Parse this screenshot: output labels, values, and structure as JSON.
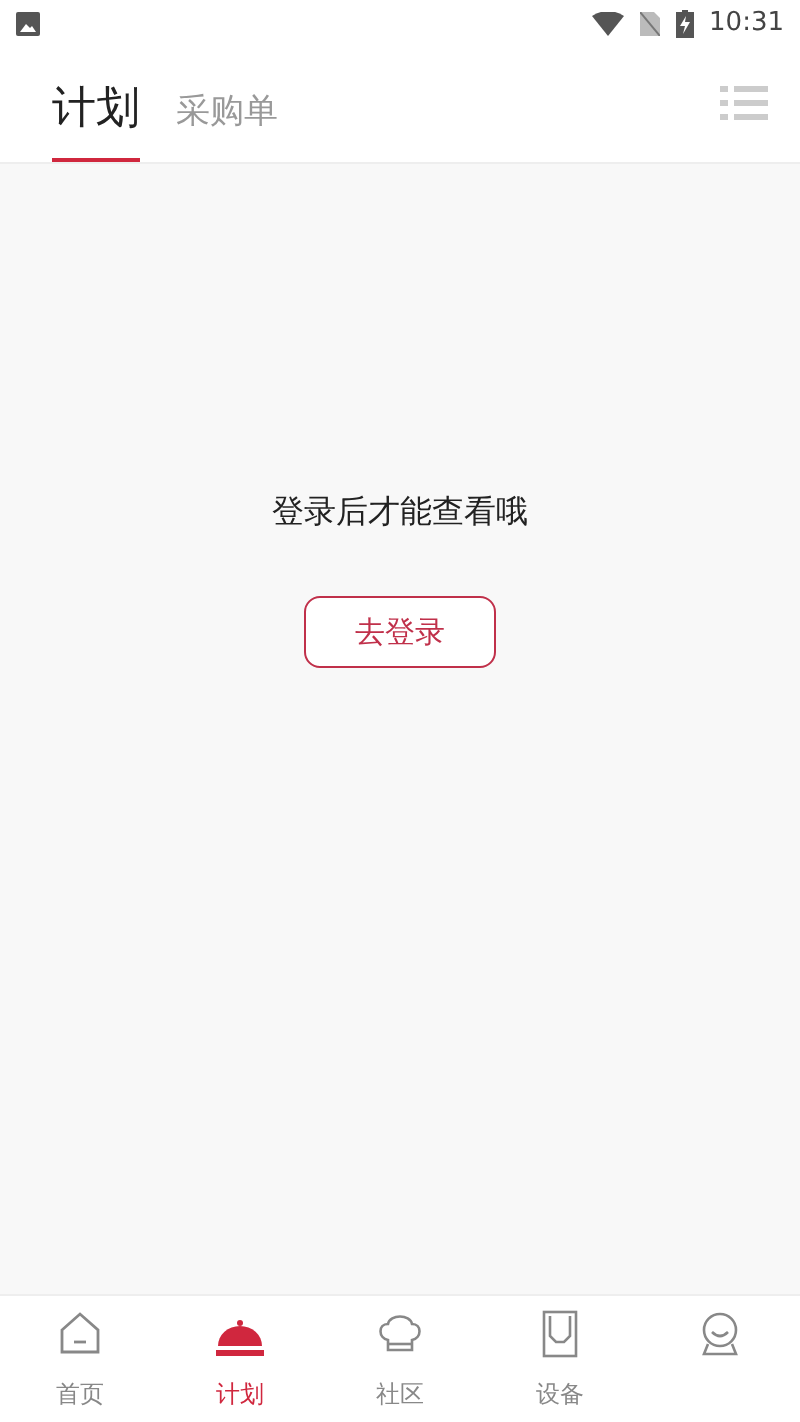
{
  "status_bar": {
    "time": "10:31"
  },
  "tabs": [
    {
      "label": "计划",
      "selected": true
    },
    {
      "label": "采购单",
      "selected": false
    }
  ],
  "empty_state": {
    "message": "登录后才能查看哦",
    "button": "去登录"
  },
  "bottom_nav": [
    {
      "kind": "home",
      "label": "首页",
      "selected": false
    },
    {
      "kind": "cloche",
      "label": "计划",
      "selected": true
    },
    {
      "kind": "chef",
      "label": "社区",
      "selected": false
    },
    {
      "kind": "device",
      "label": "设备",
      "selected": false
    },
    {
      "kind": "user",
      "selected": false
    }
  ]
}
